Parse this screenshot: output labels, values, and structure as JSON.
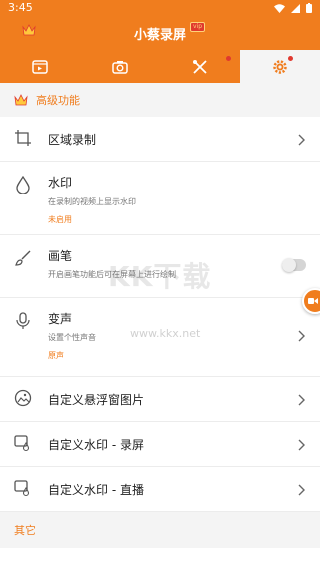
{
  "status_bar": {
    "time": "3:45"
  },
  "app_bar": {
    "title": "小蔡录屏",
    "badge": "vip"
  },
  "tabs": [
    {
      "name": "video-list",
      "active": false
    },
    {
      "name": "camera",
      "active": false,
      "dot": false
    },
    {
      "name": "tools",
      "active": false,
      "dot": true
    },
    {
      "name": "settings",
      "active": true,
      "dot": true
    }
  ],
  "sections": {
    "advanced": {
      "label": "高级功能"
    },
    "other": {
      "label": "其它"
    }
  },
  "rows": {
    "region": {
      "title": "区域录制"
    },
    "watermark": {
      "title": "水印",
      "subtitle": "在录制的视频上显示水印",
      "status": "未启用"
    },
    "brush": {
      "title": "画笔",
      "subtitle": "开启画笔功能后可在屏幕上进行绘制",
      "enabled": false
    },
    "voice": {
      "title": "变声",
      "subtitle": "设置个性声音",
      "status": "原声"
    },
    "float_image": {
      "title": "自定义悬浮窗图片"
    },
    "wm_record": {
      "title": "自定义水印 - 录屏"
    },
    "wm_live": {
      "title": "自定义水印 - 直播"
    }
  },
  "watermark_overlay": {
    "text": "KK下载",
    "url": "www.kkx.net"
  },
  "colors": {
    "accent": "#f07d1e",
    "dot": "#e0392f"
  }
}
